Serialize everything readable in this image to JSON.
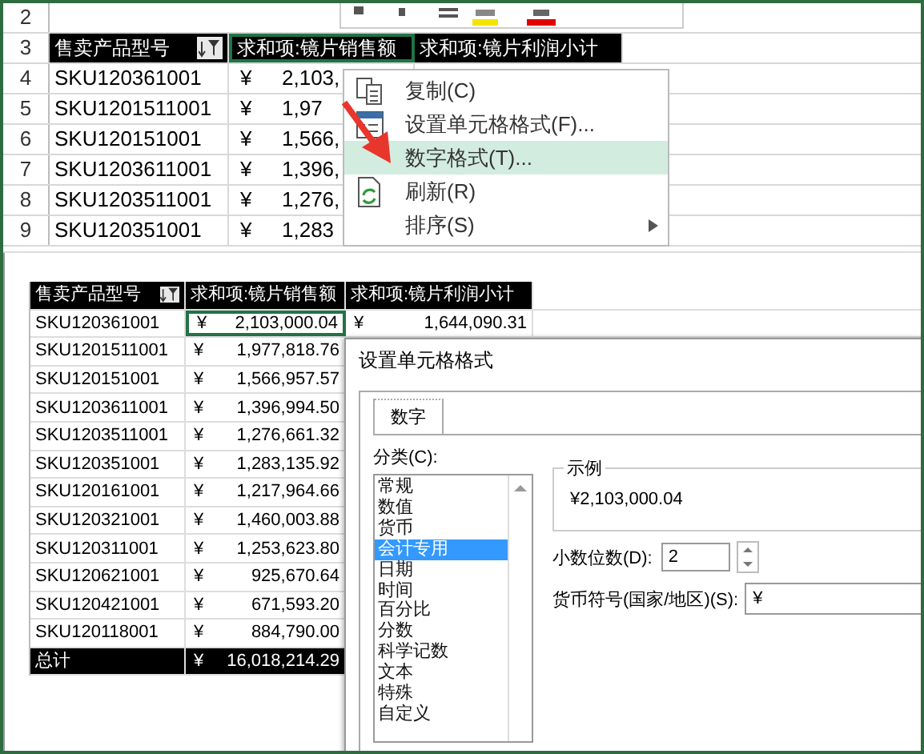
{
  "top_view": {
    "row_numbers": [
      "2",
      "3",
      "4",
      "5",
      "6",
      "7",
      "8",
      "9"
    ],
    "header": [
      "售卖产品型号",
      "求和项:镜片销售额",
      "求和项:镜片利润小计"
    ],
    "rows": [
      {
        "product": "SKU120361001",
        "currency": "¥",
        "amount": "2,103,"
      },
      {
        "product": "SKU1201511001",
        "currency": "¥",
        "amount": "1,97"
      },
      {
        "product": "SKU120151001",
        "currency": "¥",
        "amount": "1,566,"
      },
      {
        "product": "SKU1203611001",
        "currency": "¥",
        "amount": "1,396,"
      },
      {
        "product": "SKU1203511001",
        "currency": "¥",
        "amount": "1,276,"
      },
      {
        "product": "SKU120351001",
        "currency": "¥",
        "amount": "1,283"
      }
    ],
    "context_menu": {
      "items": [
        {
          "label": "复制(C)",
          "selected": false,
          "submenu": false
        },
        {
          "label": "设置单元格格式(F)...",
          "selected": false,
          "submenu": false
        },
        {
          "label": "数字格式(T)...",
          "selected": true,
          "submenu": false
        },
        {
          "label": "刷新(R)",
          "selected": false,
          "submenu": false
        },
        {
          "label": "排序(S)",
          "selected": false,
          "submenu": true
        }
      ]
    }
  },
  "bottom_view": {
    "header": [
      "售卖产品型号",
      "求和项:镜片销售额",
      "求和项:镜片利润小计"
    ],
    "rows": [
      {
        "product": "SKU120361001",
        "currency": "¥",
        "amount": "2,103,000.04"
      },
      {
        "product": "SKU1201511001",
        "currency": "¥",
        "amount": "1,977,818.76"
      },
      {
        "product": "SKU120151001",
        "currency": "¥",
        "amount": "1,566,957.57"
      },
      {
        "product": "SKU1203611001",
        "currency": "¥",
        "amount": "1,396,994.50"
      },
      {
        "product": "SKU1203511001",
        "currency": "¥",
        "amount": "1,276,661.32"
      },
      {
        "product": "SKU120351001",
        "currency": "¥",
        "amount": "1,283,135.92"
      },
      {
        "product": "SKU120161001",
        "currency": "¥",
        "amount": "1,217,964.66"
      },
      {
        "product": "SKU120321001",
        "currency": "¥",
        "amount": "1,460,003.88"
      },
      {
        "product": "SKU120311001",
        "currency": "¥",
        "amount": "1,253,623.80"
      },
      {
        "product": "SKU120621001",
        "currency": "¥",
        "amount": "925,670.64"
      },
      {
        "product": "SKU120421001",
        "currency": "¥",
        "amount": "671,593.20"
      },
      {
        "product": "SKU120118001",
        "currency": "¥",
        "amount": "884,790.00"
      }
    ],
    "total": {
      "label": "总计",
      "currency": "¥",
      "amount": "16,018,214.29"
    },
    "profit_first": {
      "currency": "¥",
      "amount": "1,644,090.31"
    },
    "dialog": {
      "title": "设置单元格格式",
      "tabs": [
        {
          "label": "数字",
          "selected": true
        }
      ],
      "category_label": "分类(C):",
      "categories": [
        {
          "label": "常规",
          "selected": false
        },
        {
          "label": "数值",
          "selected": false
        },
        {
          "label": "货币",
          "selected": false
        },
        {
          "label": "会计专用",
          "selected": true
        },
        {
          "label": "日期",
          "selected": false
        },
        {
          "label": "时间",
          "selected": false
        },
        {
          "label": "百分比",
          "selected": false
        },
        {
          "label": "分数",
          "selected": false
        },
        {
          "label": "科学记数",
          "selected": false
        },
        {
          "label": "文本",
          "selected": false
        },
        {
          "label": "特殊",
          "selected": false
        },
        {
          "label": "自定义",
          "selected": false
        }
      ],
      "sample_label": "示例",
      "sample_value": "¥2,103,000.04",
      "decimal_label": "小数位数(D):",
      "decimal_value": "2",
      "currency_label": "货币符号(国家/地区)(S):",
      "currency_value": "¥"
    }
  }
}
